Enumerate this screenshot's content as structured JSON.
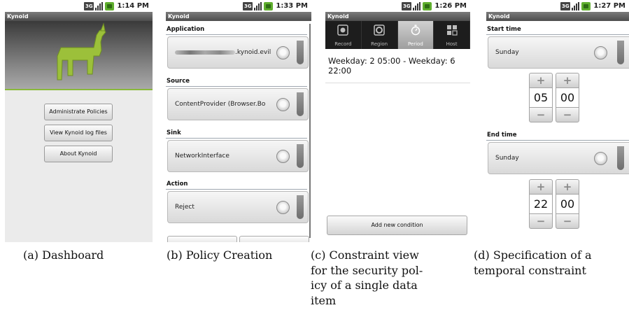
{
  "panels": {
    "a": {
      "time": "1:14 PM",
      "title": "Kynoid",
      "buttons": [
        "Administrate Policies",
        "View Kynoid log files",
        "About Kynoid"
      ],
      "caption": "(a) Dashboard",
      "logo_color": "#9cc03a"
    },
    "b": {
      "time": "1:33 PM",
      "title": "Kynoid",
      "sections": [
        {
          "label": "Application",
          "value": ".kynoid.evil"
        },
        {
          "label": "Source",
          "value": "ContentProvider (Browser.Bo"
        },
        {
          "label": "Sink",
          "value": "NetworkInterface"
        },
        {
          "label": "Action",
          "value": "Reject"
        }
      ],
      "caption": "(b) Policy Creation"
    },
    "c": {
      "time": "1:26 PM",
      "title": "Kynoid",
      "tabs": [
        "Record",
        "Region",
        "Period",
        "Host"
      ],
      "active_tab": "Period",
      "condition": "Weekday: 2 05:00 - Weekday: 6 22:00",
      "add_button": "Add new condition",
      "caption_lines": [
        "(c)  Constraint  view",
        "for  the  security  pol-",
        "icy  of  a  single  data",
        "item"
      ]
    },
    "d": {
      "time": "1:27 PM",
      "title": "Kynoid",
      "start_label": "Start time",
      "start_day": "Sunday",
      "start_hour": "05",
      "start_min": "00",
      "end_label": "End time",
      "end_day": "Sunday",
      "end_hour": "22",
      "end_min": "00",
      "plus": "+",
      "minus": "−",
      "caption_lines": [
        "(d) Specification of a",
        "temporal constraint"
      ]
    }
  },
  "colors": {
    "accent_green": "#8ab93a",
    "battery_green": "#5fae2e",
    "titlebar_gray": "#4d4d4d"
  }
}
